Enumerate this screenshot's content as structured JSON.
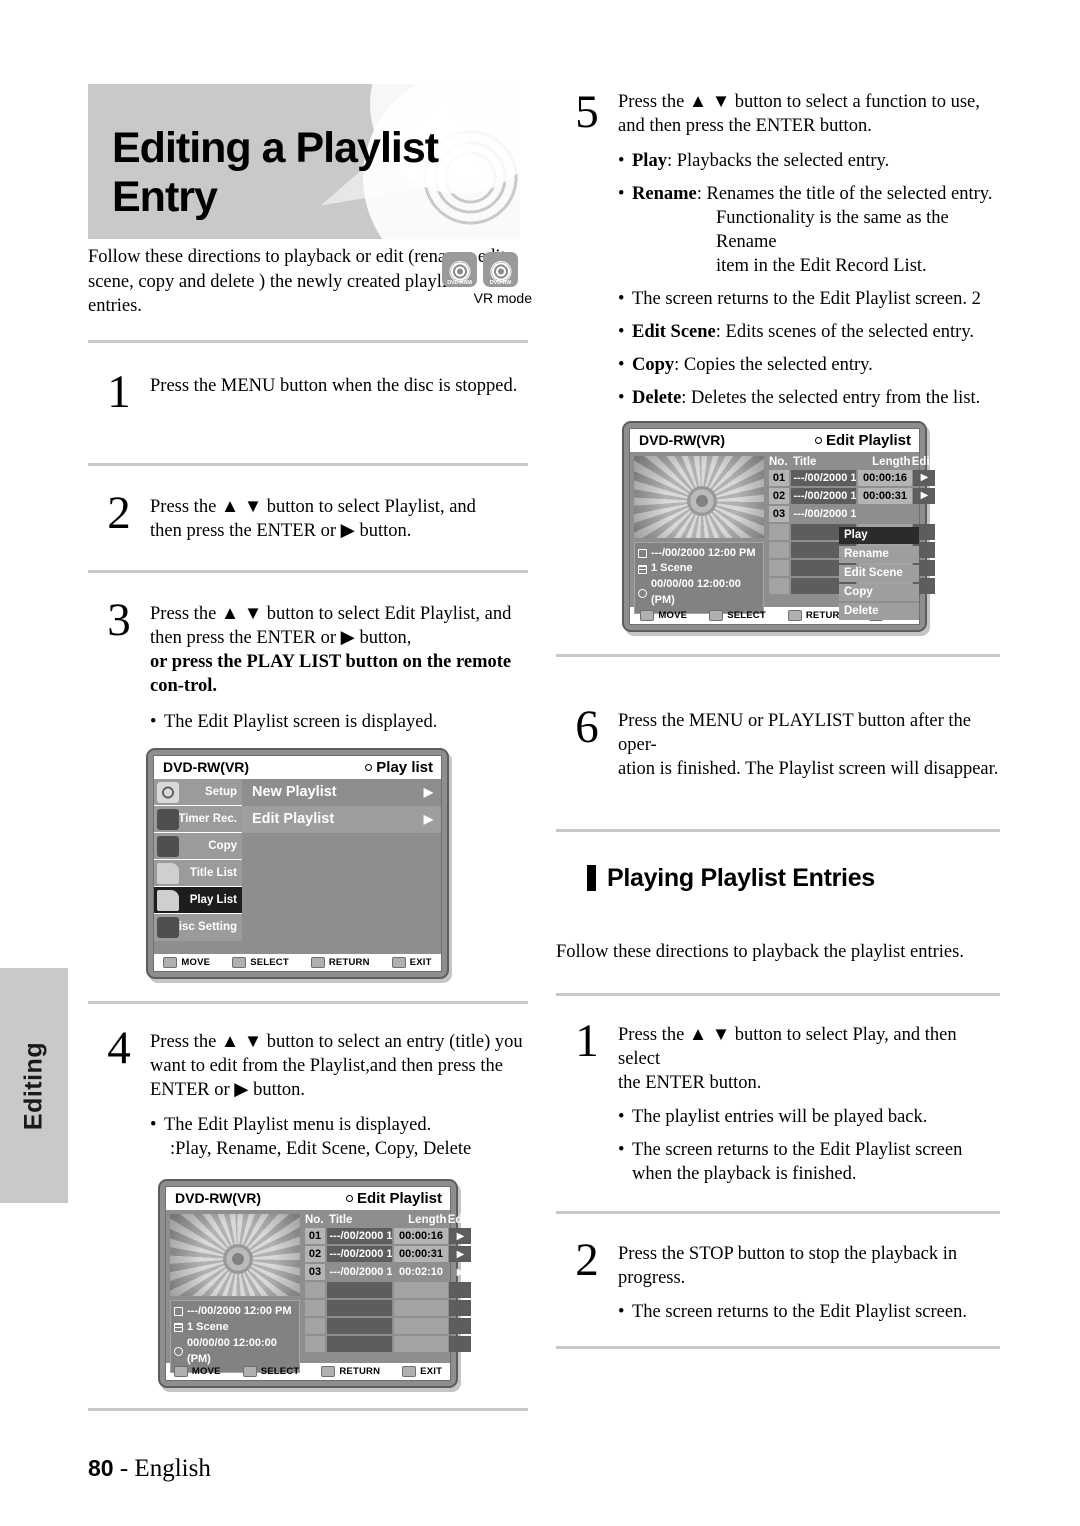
{
  "side_tab": {
    "label": "Editing"
  },
  "header": {
    "title": "Editing a Playlist Entry",
    "badges": [
      {
        "name": "dvd-ram-badge",
        "label": "DVD-RAM"
      },
      {
        "name": "dvd-rw-badge",
        "label": "DVD-RW"
      }
    ],
    "mode_label": "VR mode",
    "intro": "Follow these directions to playback or edit (rename, edit scene, copy and delete ) the newly created playlist entries."
  },
  "left_steps": [
    {
      "num": "1",
      "text": "Press the MENU button when the disc is stopped."
    },
    {
      "num": "2",
      "line1": "Press the ▲ ▼ button to select Playlist, and",
      "line2": "then press the ENTER or ▶ button."
    },
    {
      "num": "3",
      "line1": "Press the ▲ ▼ button to select Edit Playlist, and",
      "line2": "then press the ENTER or ▶ button,",
      "bold_line": "or press the PLAY LIST button on the remote con-trol.",
      "bullet": "The Edit Playlist screen is displayed."
    },
    {
      "num": "4",
      "line1": "Press the ▲ ▼ button to select an entry (title) you",
      "line2": "want to edit from the Playlist,and then press the",
      "line3": "ENTER or ▶ button.",
      "bullet": "The Edit Playlist menu is displayed.",
      "bullet_sub": ":Play, Rename, Edit Scene, Copy, Delete"
    }
  ],
  "right_steps": [
    {
      "num": "5",
      "line1": "Press the ▲ ▼ button to select a function to use,",
      "line2": "and then press the ENTER button.",
      "bullets": [
        {
          "term": "Play",
          "desc": ": Playbacks the selected entry."
        },
        {
          "term": "Rename",
          "desc": ": Renames the title of the selected entry.",
          "cont1": "Functionality is the same as the Rename",
          "cont2": "item in the Edit Record List."
        },
        {
          "term": "",
          "desc": "The screen returns to the Edit Playlist screen. 2"
        },
        {
          "term": "Edit Scene",
          "desc": ": Edits scenes of the selected entry."
        },
        {
          "term": "Copy",
          "desc": ": Copies the selected entry."
        },
        {
          "term": "Delete",
          "desc": ": Deletes the selected entry from the list."
        }
      ]
    },
    {
      "num": "6",
      "line1": "Press the MENU or PLAYLIST button after the oper-",
      "line2": "ation is finished. The Playlist screen will disappear."
    }
  ],
  "section2": {
    "heading": "Playing Playlist Entries",
    "intro": "Follow these directions to playback the playlist entries.",
    "steps": [
      {
        "num": "1",
        "line1": "Press the ▲ ▼ button to select Play, and then select",
        "line2": "the ENTER button.",
        "bullets": [
          "The playlist entries will be played back.",
          "The screen returns to the Edit Playlist screen when the playback is finished."
        ]
      },
      {
        "num": "2",
        "line1": "Press the STOP button to stop the playback in",
        "line2": "progress.",
        "bullets": [
          "The screen returns to the Edit Playlist screen."
        ]
      }
    ]
  },
  "osd_common": {
    "disc_label": "DVD-RW(VR)",
    "footer": [
      {
        "icon": "dpad-icon",
        "label": "MOVE"
      },
      {
        "icon": "enter-icon",
        "label": "SELECT"
      },
      {
        "icon": "return-icon",
        "label": "RETURN"
      },
      {
        "icon": "exit-icon",
        "label": "EXIT"
      }
    ]
  },
  "osd_playlist_menu": {
    "title": "Play list",
    "side_items": [
      {
        "label": "Setup",
        "icon": "gear-icon",
        "selected": false
      },
      {
        "label": "Timer Rec.",
        "icon": "timer-icon",
        "selected": false
      },
      {
        "label": "Copy",
        "icon": "copy-icon",
        "selected": false
      },
      {
        "label": "Title List",
        "icon": "title-list-icon",
        "selected": false
      },
      {
        "label": "Play List",
        "icon": "play-list-icon",
        "selected": true
      },
      {
        "label": "Disc Setting",
        "icon": "disc-setting-icon",
        "selected": false
      }
    ],
    "rows": [
      {
        "label": "New Playlist",
        "arrow": "▶",
        "highlighted": false
      },
      {
        "label": "Edit Playlist",
        "arrow": "▶",
        "highlighted": true
      }
    ]
  },
  "osd_edit_playlist": {
    "title": "Edit Playlist",
    "columns": {
      "no": "No.",
      "title": "Title",
      "length": "Length",
      "edit": "Edit"
    },
    "rows": [
      {
        "no": "01",
        "title": "---/00/2000 1",
        "length": "00:00:16",
        "edit": "▶",
        "style": "filled"
      },
      {
        "no": "02",
        "title": "---/00/2000 1",
        "length": "00:00:31",
        "edit": "▶",
        "style": "filled"
      },
      {
        "no": "03",
        "title": "---/00/2000 1",
        "length": "00:02:10",
        "edit": "▶",
        "style": "plain"
      }
    ],
    "empty_rows": 4,
    "info": {
      "date": "---/00/2000 12:00 PM",
      "scene": "1 Scene",
      "time": "00/00/00 12:00:00 (PM)"
    }
  },
  "osd_edit_playlist_popup": {
    "title": "Edit Playlist",
    "columns": {
      "no": "No.",
      "title": "Title",
      "length": "Length",
      "edit": "Edit"
    },
    "rows": [
      {
        "no": "01",
        "title": "---/00/2000 1",
        "length": "00:00:16",
        "edit": "▶",
        "style": "filled"
      },
      {
        "no": "02",
        "title": "---/00/2000 1",
        "length": "00:00:31",
        "edit": "▶",
        "style": "filled"
      },
      {
        "no": "03",
        "title": "---/00/2000 1",
        "length": "",
        "edit": "",
        "style": "plain"
      }
    ],
    "empty_rows": 4,
    "menu": [
      {
        "label": "Play",
        "selected": true
      },
      {
        "label": "Rename",
        "selected": false
      },
      {
        "label": "Edit Scene",
        "selected": false
      },
      {
        "label": "Copy",
        "selected": false
      },
      {
        "label": "Delete",
        "selected": false
      }
    ],
    "info": {
      "date": "---/00/2000 12:00 PM",
      "scene": "1 Scene",
      "time": "00/00/00 12:00:00 (PM)"
    }
  },
  "footer": {
    "page": "80",
    "sep": "-",
    "lang": "English"
  }
}
